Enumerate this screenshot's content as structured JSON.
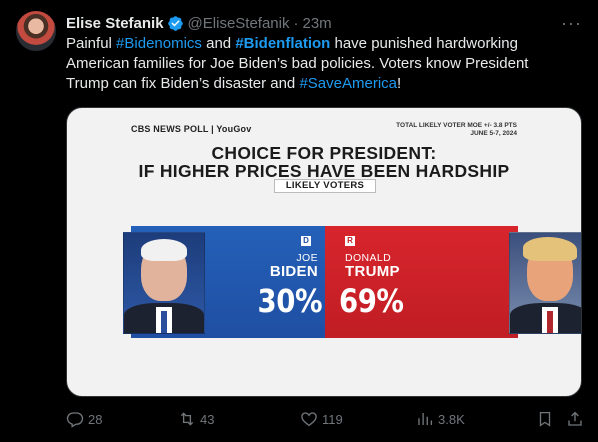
{
  "tweet": {
    "author_name": "Elise Stefanik",
    "handle": "@EliseStefanik",
    "separator": "·",
    "time": "23m",
    "more": "···",
    "text": {
      "p1": "Painful ",
      "tag1": "#Bidenomics",
      "p2": " and ",
      "tag2": "#Bidenflation",
      "p3": " have punished hardworking American families for Joe Biden’s bad policies. Voters know President Trump can fix Biden’s disaster and ",
      "tag3": "#SaveAmerica",
      "p4": "!"
    }
  },
  "card": {
    "poll_source": "CBS NEWS POLL | YouGov",
    "poll_meta_line1": "TOTAL LIKELY VOTER MOE +/- 3.8 PTS",
    "poll_meta_line2": "JUNE 5-7, 2024",
    "headline_line1": "CHOICE FOR PRESIDENT:",
    "headline_line2": "IF HIGHER PRICES HAVE BEEN HARDSHIP",
    "subtitle": "LIKELY VOTERS",
    "left": {
      "party": "D",
      "first": "JOE",
      "last": "BIDEN",
      "percent": "30%"
    },
    "right": {
      "party": "R",
      "first": "DONALD",
      "last": "TRUMP",
      "percent": "69%"
    }
  },
  "chart_data": {
    "type": "bar",
    "categories": [
      "BIDEN",
      "TRUMP"
    ],
    "values": [
      30,
      69
    ],
    "title": "CHOICE FOR PRESIDENT: IF HIGHER PRICES HAVE BEEN HARDSHIP",
    "subtitle": "LIKELY VOTERS"
  },
  "actions": {
    "replies": "28",
    "retweets": "43",
    "likes": "119",
    "views": "3.8K"
  },
  "icons": [
    "verified-icon",
    "more-icon",
    "reply-icon",
    "retweet-icon",
    "like-icon",
    "views-icon",
    "bookmark-icon",
    "share-icon"
  ],
  "colors": {
    "link": "#1d9bf0",
    "muted": "#71767b",
    "dem_blue": "#1f4fa3",
    "rep_red": "#c01d24"
  }
}
